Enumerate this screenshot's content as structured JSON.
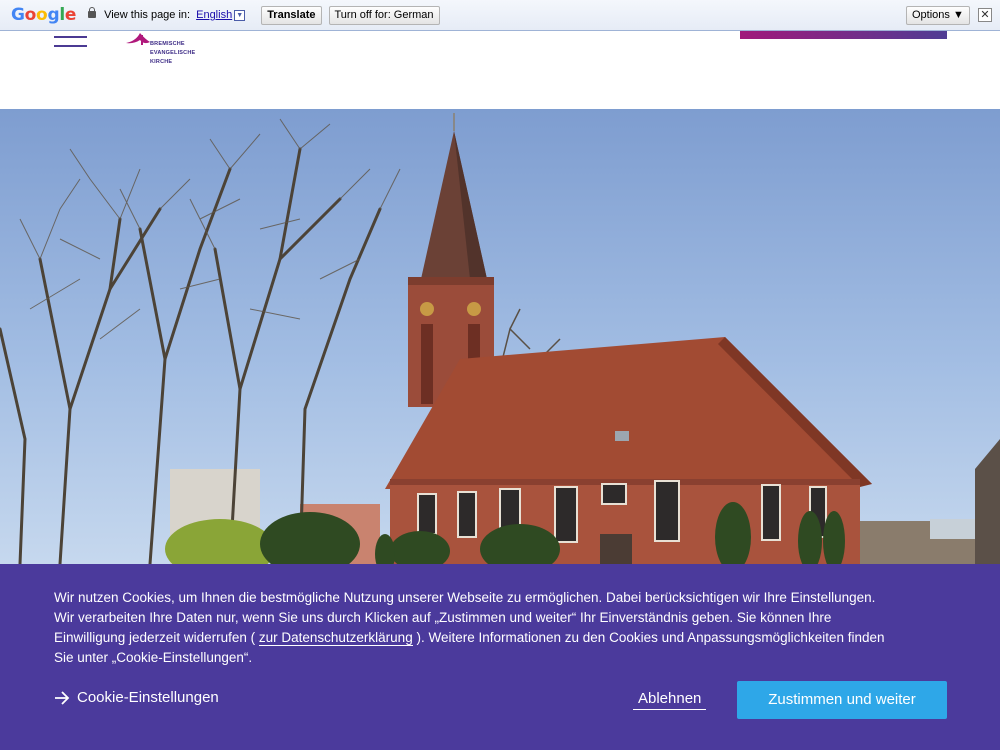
{
  "translate_bar": {
    "view_label": "View this page in:",
    "language": "English",
    "translate_button": "Translate",
    "turn_off_button": "Turn off for: German",
    "options_button": "Options ▼",
    "close_glyph": "✕",
    "caret_glyph": "▼"
  },
  "header": {
    "logo_lines": [
      "BREMISCHE",
      "EVANGELISCHE",
      "KIRCHE"
    ]
  },
  "hero": {
    "image_alt": "Church with red-brick walls and tall spire among bare trees"
  },
  "cookie": {
    "text_part1": "Wir nutzen Cookies, um Ihnen die bestmögliche Nutzung unserer Webseite zu ermöglichen. Dabei berücksichtigen wir Ihre Einstellungen. Wir verarbeiten Ihre Daten nur, wenn Sie uns durch Klicken auf „Zustimmen und weiter“ Ihr Einverständnis geben. Sie können Ihre Einwilligung jederzeit widerrufen (",
    "privacy_link": "zur Datenschutzerklärung",
    "text_part2": "). Weitere Informationen zu den Cookies und Anpassungsmöglichkeiten finden Sie unter „Cookie-Einstellungen“.",
    "settings_label": "Cookie-Einstellungen",
    "decline_label": "Ablehnen",
    "accept_label": "Zustimmen und weiter"
  },
  "colors": {
    "banner_bg": "#4b3a9c",
    "accept_bg": "#2ea7e8",
    "brand": "#4b3a93"
  }
}
